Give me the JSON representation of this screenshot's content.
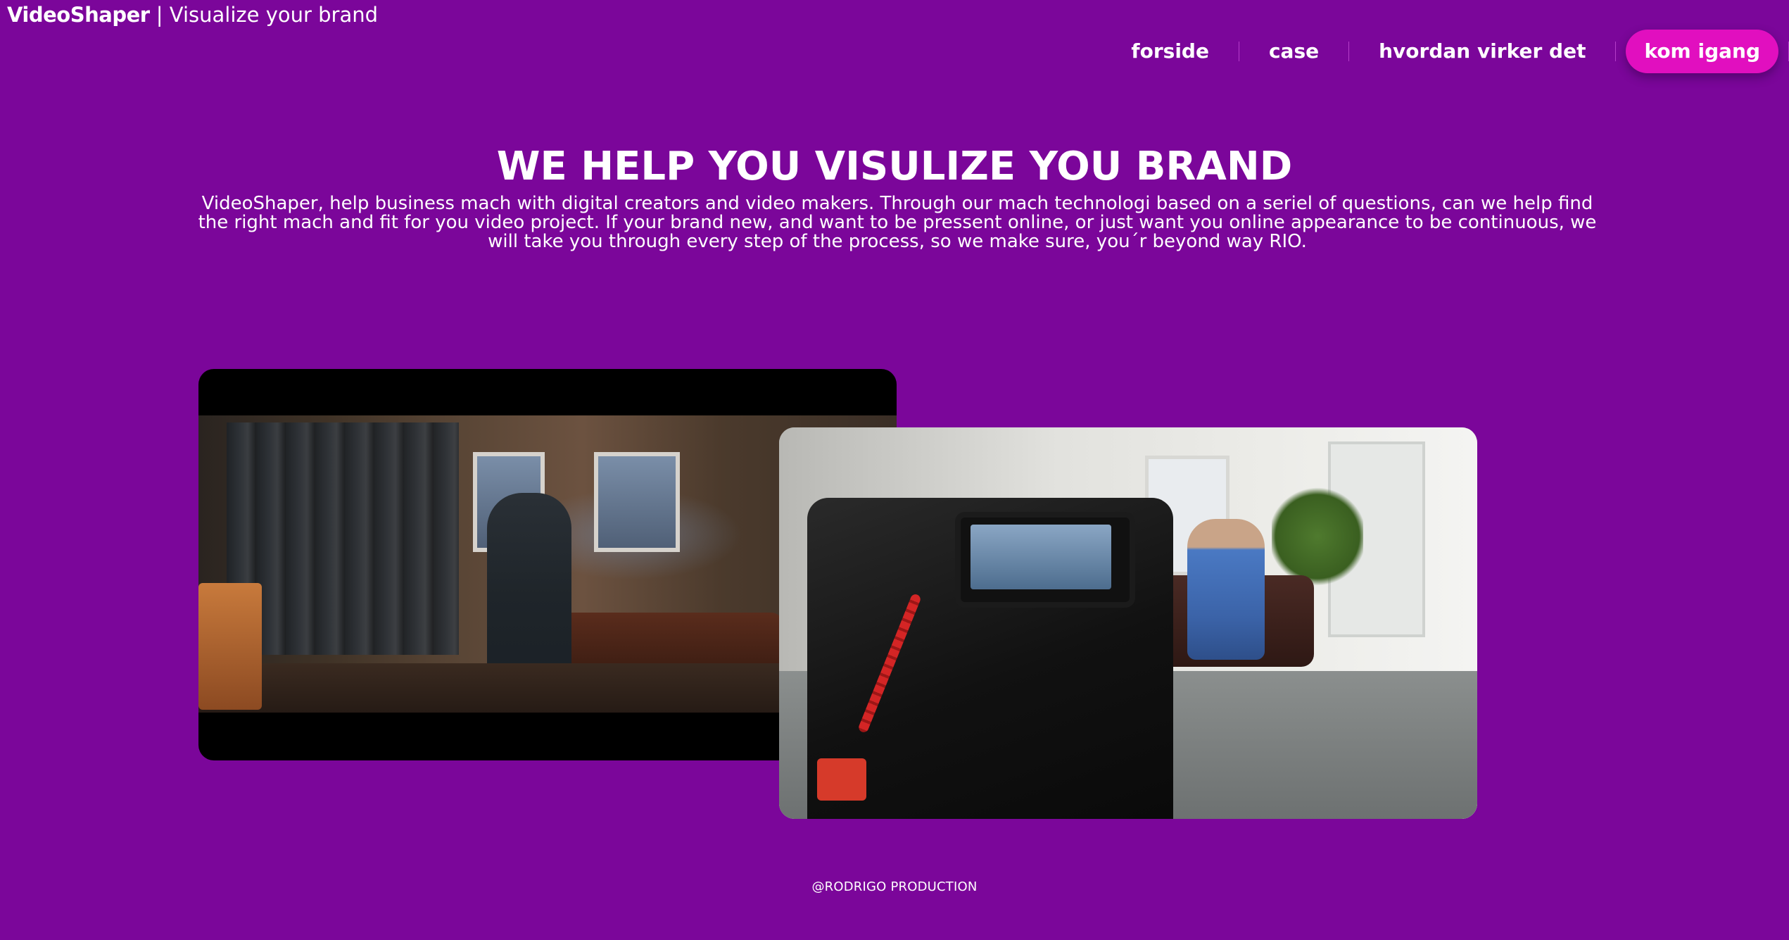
{
  "header": {
    "brand_name": "VideoShaper",
    "brand_separator": "|",
    "brand_tagline": "Visualize your brand"
  },
  "nav": {
    "items": [
      {
        "label": "forside"
      },
      {
        "label": "case"
      },
      {
        "label": "hvordan virker det"
      }
    ],
    "cta_label": "kom igang"
  },
  "hero": {
    "title": "WE HELP YOU VISULIZE YOU BRAND",
    "text": "VideoShaper, help business mach with digital creators and video makers. Through our mach technologi based on a seriel of questions, can we help find the right mach and fit for you video project. If your brand new, and want to be pressent online, or just want you online appearance to be continuous, we will take you through every step of the process, so we make sure, you´r beyond way RIO."
  },
  "footer": {
    "credit": "@RODRIGO PRODUCTION"
  },
  "colors": {
    "background": "#7b069a",
    "cta": "#e10fbf",
    "text": "#ffffff"
  }
}
